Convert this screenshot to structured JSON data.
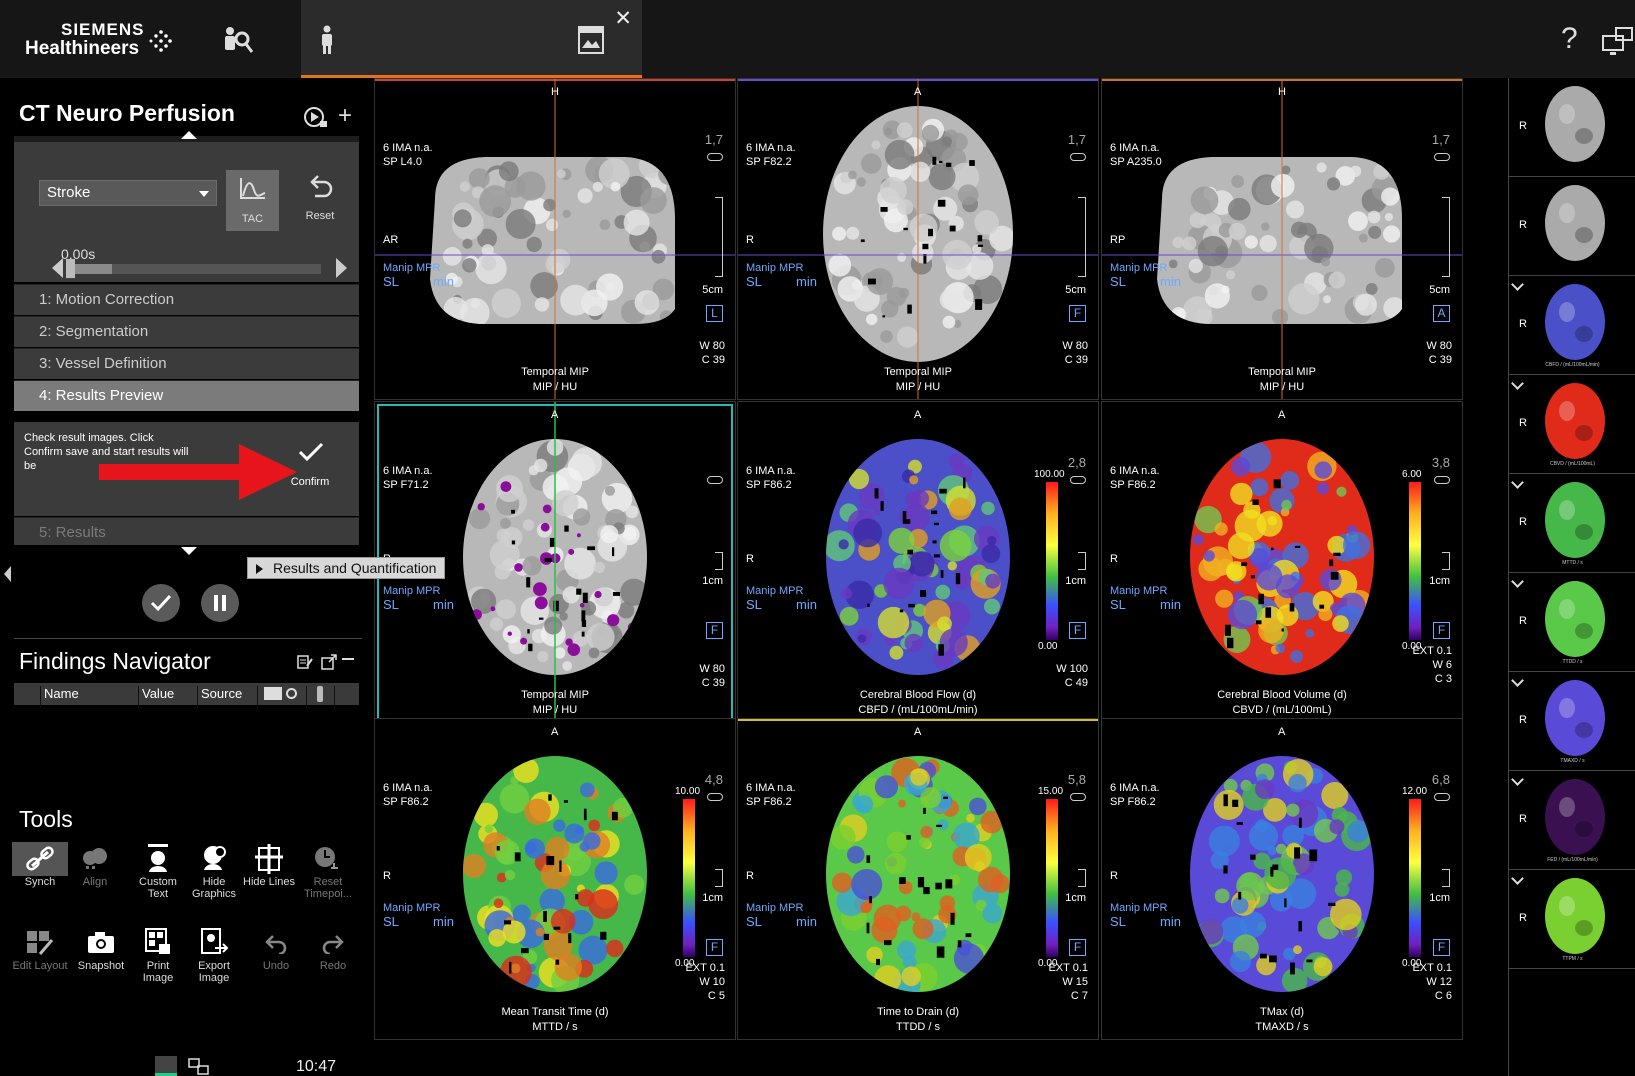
{
  "brand": {
    "line1": "SIEMENS",
    "line2": "Healthineers"
  },
  "top_icons": {
    "patient_browser": "patient-browser-icon",
    "patient": "patient-icon",
    "report": "report-icon",
    "help": "?",
    "monitor": "monitor-icon"
  },
  "app": {
    "title": "CT Neuro Perfusion"
  },
  "workflow": {
    "protocol_value": "Stroke",
    "tac_label": "TAC",
    "reset_label": "Reset",
    "time_value": "0.00s",
    "steps": [
      {
        "label": "1: Motion Correction",
        "state": "done"
      },
      {
        "label": "2: Segmentation",
        "state": "done"
      },
      {
        "label": "3: Vessel Definition",
        "state": "done"
      },
      {
        "label": "4: Results Preview",
        "state": "active"
      },
      {
        "label": "5: Results",
        "state": "disabled"
      }
    ],
    "step_description": "Check result images. Click Confirm save and start results will be",
    "confirm_label": "Confirm",
    "tooltip": "Results and Quantification"
  },
  "findings": {
    "title": "Findings Navigator",
    "columns": [
      "Name",
      "Value",
      "Source"
    ]
  },
  "tools": {
    "title": "Tools",
    "items": [
      {
        "label": "Synch",
        "icon": "link-icon"
      },
      {
        "label": "Align",
        "icon": "align-icon"
      },
      {
        "label": "Custom Text",
        "icon": "custom-text-icon"
      },
      {
        "label": "Hide Graphics",
        "icon": "hide-graphics-icon"
      },
      {
        "label": "Hide Lines",
        "icon": "hide-lines-icon"
      },
      {
        "label": "Reset Timepoi...",
        "icon": "reset-timepoint-icon"
      },
      {
        "label": "Edit Layout",
        "icon": "edit-layout-icon"
      },
      {
        "label": "Snapshot",
        "icon": "camera-icon"
      },
      {
        "label": "Print Image",
        "icon": "print-icon"
      },
      {
        "label": "Export Image",
        "icon": "export-icon"
      },
      {
        "label": "Undo",
        "icon": "undo-icon"
      },
      {
        "label": "Redo",
        "icon": "redo-icon"
      }
    ]
  },
  "clock": "10:47",
  "viewports": [
    {
      "orient_top": "H",
      "orient_left": "AR",
      "info1": "6 IMA n.a.",
      "info2": "SP L4.0",
      "manip": "Manip MPR",
      "sl": "SL",
      "min": "min",
      "zoom": "1,7",
      "scale": "5cm",
      "wc": "W 80\nC 39",
      "cap1": "Temporal MIP",
      "cap2": "MIP / HU",
      "box": "L",
      "topline": "#d0402a"
    },
    {
      "orient_top": "A",
      "orient_left": "R",
      "info1": "6 IMA n.a.",
      "info2": "SP F82.2",
      "manip": "Manip MPR",
      "sl": "SL",
      "min": "min",
      "zoom": "1,7",
      "scale": "5cm",
      "wc": "W 80\nC 39",
      "cap1": "Temporal MIP",
      "cap2": "MIP / HU",
      "box": "F",
      "topline": "#6a4ad0"
    },
    {
      "orient_top": "H",
      "orient_left": "RP",
      "info1": "6 IMA n.a.",
      "info2": "SP A235.0",
      "manip": "Manip MPR",
      "sl": "SL",
      "min": "min",
      "zoom": "1,7",
      "scale": "5cm",
      "wc": "W 80\nC 39",
      "cap1": "Temporal MIP",
      "cap2": "MIP / HU",
      "box": "A",
      "topline": "#d07030"
    },
    {
      "orient_top": "A",
      "orient_left": "R",
      "info1": "6 IMA n.a.",
      "info2": "SP F71.2",
      "manip": "Manip MPR",
      "sl": "SL",
      "min": "min",
      "zoom": "",
      "scale": "1cm",
      "wc": "W 80\nC 39",
      "cap1": "Temporal MIP",
      "cap2": "MIP / HU",
      "box": "F",
      "topline": "#000"
    },
    {
      "orient_top": "A",
      "orient_left": "R",
      "info1": "6 IMA n.a.",
      "info2": "SP F86.2",
      "manip": "Manip MPR",
      "sl": "SL",
      "min": "min",
      "zoom": "2,8",
      "scale": "1cm",
      "wc": "W 100\nC 49",
      "cap1": "Cerebral Blood Flow (d)",
      "cap2": "CBFD / (mL/100mL/min)",
      "box": "F",
      "cbar_max": "100.00",
      "cbar_min": "0.00",
      "topline": "#000"
    },
    {
      "orient_top": "A",
      "orient_left": "R",
      "info1": "6 IMA n.a.",
      "info2": "SP F86.2",
      "manip": "Manip MPR",
      "sl": "SL",
      "min": "min",
      "zoom": "3,8",
      "scale": "1cm",
      "wc": "EXT 0.1\nW 6\nC 3",
      "cap1": "Cerebral Blood Volume (d)",
      "cap2": "CBVD / (mL/100mL)",
      "box": "F",
      "cbar_max": "6.00",
      "cbar_min": "0.00",
      "topline": "#000"
    },
    {
      "orient_top": "A",
      "orient_left": "R",
      "info1": "6 IMA n.a.",
      "info2": "SP F86.2",
      "manip": "Manip MPR",
      "sl": "SL",
      "min": "min",
      "zoom": "4,8",
      "scale": "1cm",
      "wc": "EXT 0.1\nW 10\nC 5",
      "cap1": "Mean Transit Time (d)",
      "cap2": "MTTD / s",
      "box": "F",
      "cbar_max": "10.00",
      "cbar_min": "0.00",
      "topline": "#000"
    },
    {
      "orient_top": "A",
      "orient_left": "R",
      "info1": "6 IMA n.a.",
      "info2": "SP F86.2",
      "manip": "Manip MPR",
      "sl": "SL",
      "min": "min",
      "zoom": "5,8",
      "scale": "1cm",
      "wc": "EXT 0.1\nW 15\nC 7",
      "cap1": "Time to Drain (d)",
      "cap2": "TTDD / s",
      "box": "F",
      "cbar_max": "15.00",
      "cbar_min": "0.00",
      "topline": "#d0c030"
    },
    {
      "orient_top": "A",
      "orient_left": "R",
      "info1": "6 IMA n.a.",
      "info2": "SP F86.2",
      "manip": "Manip MPR",
      "sl": "SL",
      "min": "min",
      "zoom": "6,8",
      "scale": "1cm",
      "wc": "EXT 0.1\nW 12\nC 6",
      "cap1": "TMax (d)",
      "cap2": "TMAXD / s",
      "box": "F",
      "cbar_max": "12.00",
      "cbar_min": "0.00",
      "topline": "#000"
    }
  ],
  "thumbnails": [
    {
      "r": "R",
      "label": ""
    },
    {
      "r": "R",
      "label": ""
    },
    {
      "r": "R",
      "label": "CBFD / (mL/100mL/min)"
    },
    {
      "r": "R",
      "label": "CBVD / (mL/100mL)"
    },
    {
      "r": "R",
      "label": "MTTD / s"
    },
    {
      "r": "R",
      "label": "TTDD / s"
    },
    {
      "r": "R",
      "label": "TMAXD / s"
    },
    {
      "r": "R",
      "label": "FED / (mL/100mL/min)"
    },
    {
      "r": "R",
      "label": "TTPM / s"
    }
  ]
}
